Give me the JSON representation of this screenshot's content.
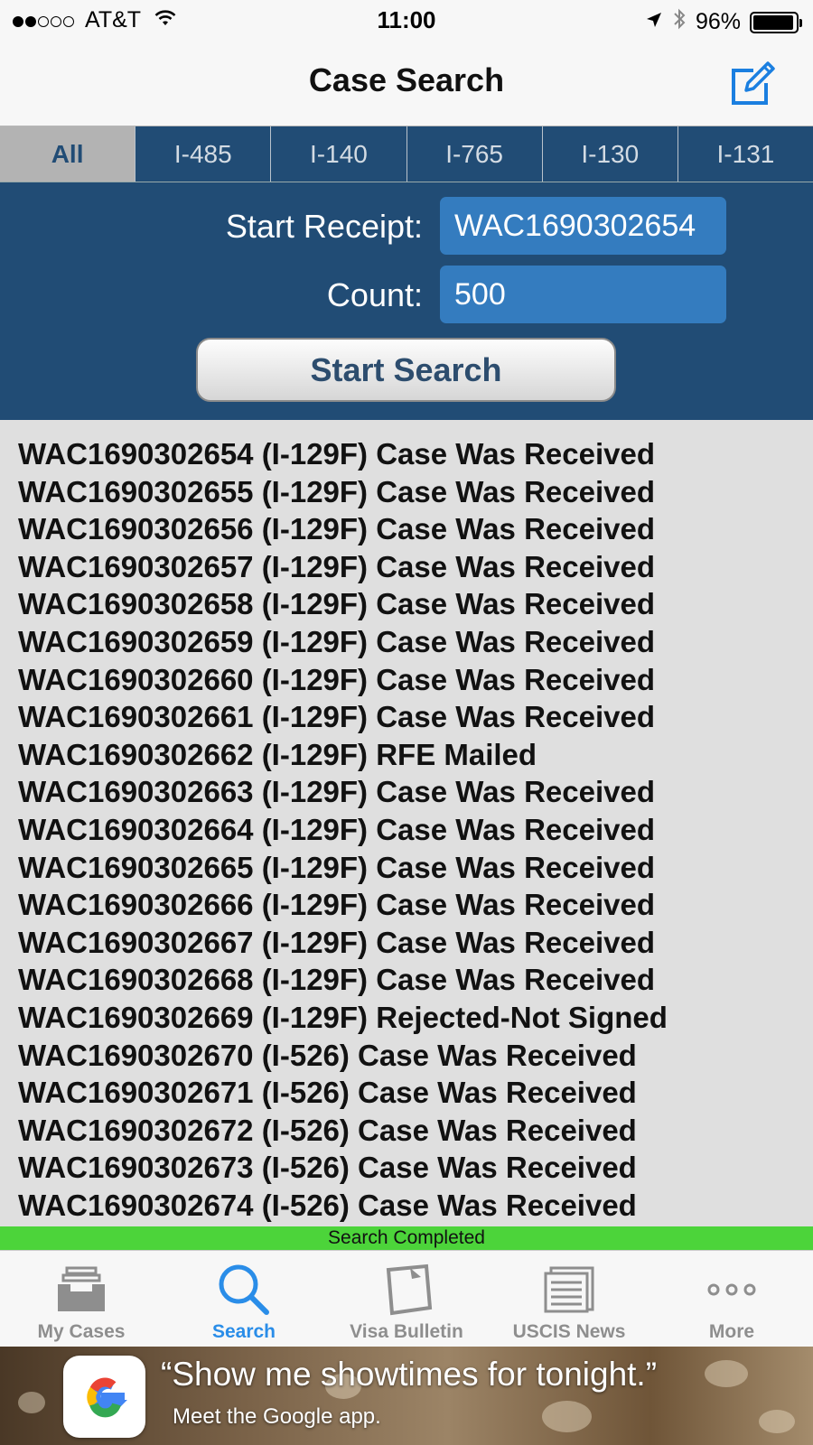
{
  "status_bar": {
    "carrier": "AT&T",
    "time": "11:00",
    "battery": "96%",
    "battery_level": 0.96,
    "signal_bars_filled": 2,
    "signal_bars_total": 5
  },
  "nav": {
    "title": "Case Search",
    "compose_icon": "compose-icon"
  },
  "tabs": [
    {
      "label": "All",
      "active": true
    },
    {
      "label": "I-485",
      "active": false
    },
    {
      "label": "I-140",
      "active": false
    },
    {
      "label": "I-765",
      "active": false
    },
    {
      "label": "I-130",
      "active": false
    },
    {
      "label": "I-131",
      "active": false
    }
  ],
  "form": {
    "start_receipt_label": "Start Receipt:",
    "start_receipt_value": "WAC1690302654",
    "count_label": "Count:",
    "count_value": "500",
    "search_button": "Start Search"
  },
  "results": [
    "WAC1690302654 (I-129F) Case Was Received",
    "WAC1690302655 (I-129F) Case Was Received",
    "WAC1690302656 (I-129F) Case Was Received",
    "WAC1690302657 (I-129F) Case Was Received",
    "WAC1690302658 (I-129F) Case Was Received",
    "WAC1690302659 (I-129F) Case Was Received",
    "WAC1690302660 (I-129F) Case Was Received",
    "WAC1690302661 (I-129F) Case Was Received",
    "WAC1690302662 (I-129F) RFE Mailed",
    "WAC1690302663 (I-129F) Case Was Received",
    "WAC1690302664 (I-129F) Case Was Received",
    "WAC1690302665 (I-129F) Case Was Received",
    "WAC1690302666 (I-129F) Case Was Received",
    "WAC1690302667 (I-129F) Case Was Received",
    "WAC1690302668 (I-129F) Case Was Received",
    "WAC1690302669 (I-129F) Rejected-Not Signed",
    "WAC1690302670 (I-526) Case Was Received",
    "WAC1690302671 (I-526) Case Was Received",
    "WAC1690302672 (I-526) Case Was Received",
    "WAC1690302673 (I-526) Case Was Received",
    "WAC1690302674 (I-526) Case Was Received"
  ],
  "status_message": "Search Completed",
  "tab_bar": [
    {
      "label": "My Cases",
      "icon": "inbox-tray-icon",
      "active": false
    },
    {
      "label": "Search",
      "icon": "search-icon",
      "active": true
    },
    {
      "label": "Visa Bulletin",
      "icon": "note-card-icon",
      "active": false
    },
    {
      "label": "USCIS News",
      "icon": "newspaper-icon",
      "active": false
    },
    {
      "label": "More",
      "icon": "more-dots-icon",
      "active": false
    }
  ],
  "ad": {
    "headline": "“Show me showtimes for tonight.”",
    "subline": "Meet the Google app.",
    "logo_icon": "google-g-icon"
  },
  "colors": {
    "header_blue": "#214c75",
    "input_blue": "#347cbf",
    "accent_blue": "#2a8de8",
    "status_green": "#4cd43a",
    "results_bg": "#dfdfdf"
  }
}
